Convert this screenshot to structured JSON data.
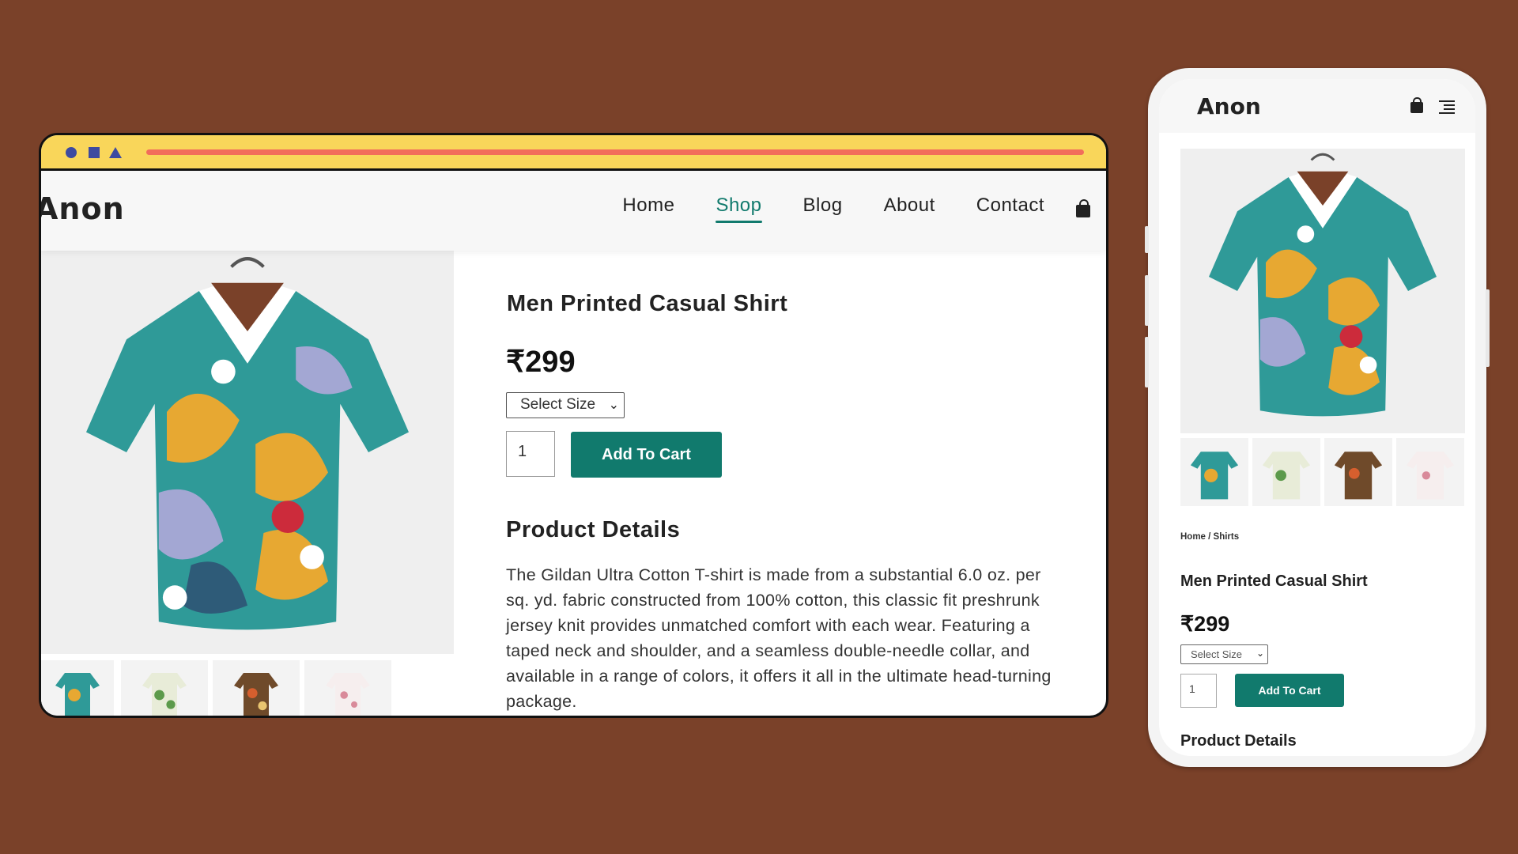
{
  "desktop": {
    "brand": "Anon",
    "nav": [
      {
        "label": "Home",
        "active": false
      },
      {
        "label": "Shop",
        "active": true
      },
      {
        "label": "Blog",
        "active": false
      },
      {
        "label": "About",
        "active": false
      },
      {
        "label": "Contact",
        "active": false
      }
    ],
    "product": {
      "title": "Men Printed Casual Shirt",
      "price": "₹299",
      "size_select": "Select Size",
      "quantity": "1",
      "add_to_cart": "Add To Cart",
      "details_heading": "Product Details",
      "description": "The Gildan Ultra Cotton T-shirt is made from a substantial 6.0 oz. per sq. yd. fabric constructed from 100% cotton, this classic fit preshrunk jersey knit provides unmatched comfort with each wear. Featuring a taped neck and shoulder, and a seamless double-needle collar, and available in a range of colors, it offers it all in the ultimate head-turning package."
    }
  },
  "mobile": {
    "brand": "Anon",
    "breadcrumb": "Home / Shirts",
    "product": {
      "title": "Men Printed Casual Shirt",
      "price": "₹299",
      "size_select": "Select Size",
      "quantity": "1",
      "add_to_cart": "Add To Cart",
      "details_heading": "Product Details"
    }
  },
  "colors": {
    "background": "#7a4129",
    "accent": "#117a6d",
    "browser_bar": "#f9d65a",
    "browser_line": "#f26d5b",
    "browser_shapes": "#3d4aa0"
  },
  "icons": [
    "circle-icon",
    "square-icon",
    "triangle-icon",
    "cart-icon",
    "menu-icon",
    "chevron-down-icon"
  ]
}
